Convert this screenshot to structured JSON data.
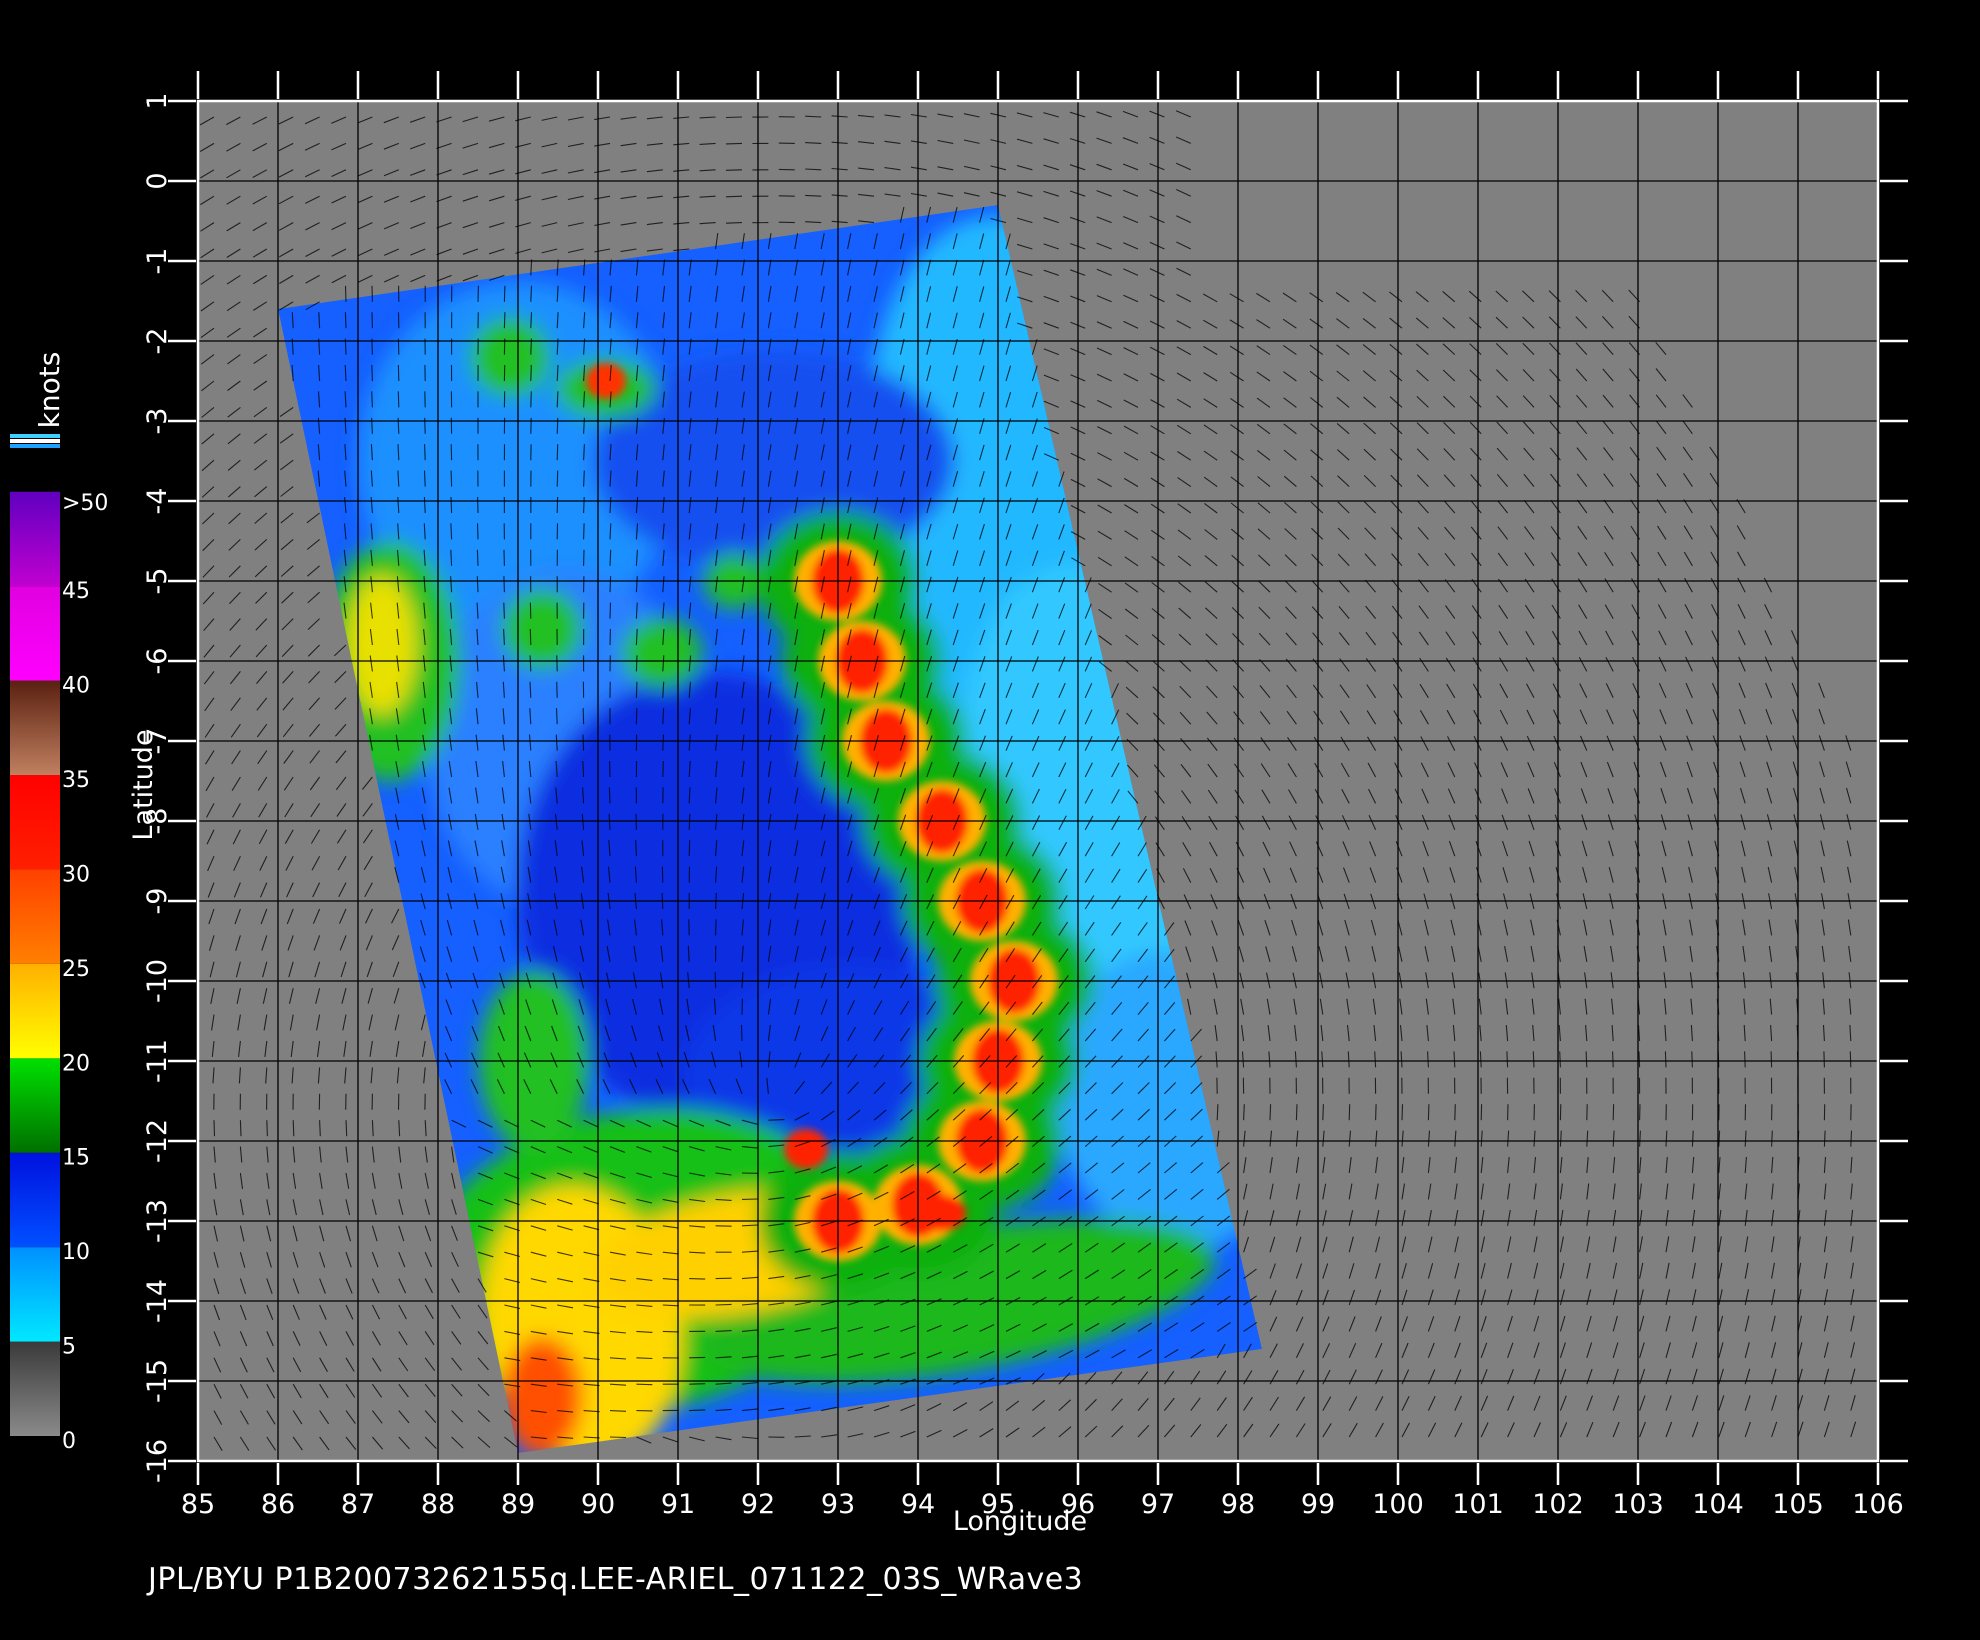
{
  "axes": {
    "xlabel": "Longitude",
    "ylabel": "Latitude",
    "lon_min": 85,
    "lon_max": 106,
    "lat_max": 1,
    "lat_min": -16,
    "lon_ticks": [
      "85",
      "86",
      "87",
      "88",
      "89",
      "90",
      "91",
      "92",
      "93",
      "94",
      "95",
      "96",
      "97",
      "98",
      "99",
      "100",
      "101",
      "102",
      "103",
      "104",
      "105",
      "106"
    ],
    "lat_ticks": [
      "1",
      "0",
      "-1",
      "-2",
      "-3",
      "-4",
      "-5",
      "-6",
      "-7",
      "-8",
      "-9",
      "-10",
      "-11",
      "-12",
      "-13",
      "-14",
      "-15",
      "-16"
    ],
    "grid": true
  },
  "colorbar": {
    "title": "knots",
    "labels": [
      ">50",
      "45",
      "40",
      "35",
      "30",
      "25",
      "20",
      "15",
      "10",
      "5",
      "0"
    ],
    "segments": [
      {
        "from": 0,
        "to": 5,
        "colors": [
          "#8a8a8a",
          "#3a3a3a"
        ]
      },
      {
        "from": 5,
        "to": 10,
        "colors": [
          "#00e8ff",
          "#0090ff"
        ]
      },
      {
        "from": 10,
        "to": 15,
        "colors": [
          "#0050ff",
          "#0010e0"
        ]
      },
      {
        "from": 15,
        "to": 20,
        "colors": [
          "#007000",
          "#00e000"
        ]
      },
      {
        "from": 20,
        "to": 25,
        "colors": [
          "#ffff00",
          "#ffb000"
        ]
      },
      {
        "from": 25,
        "to": 30,
        "colors": [
          "#ff8000",
          "#ff4000"
        ]
      },
      {
        "from": 30,
        "to": 35,
        "colors": [
          "#ff2000",
          "#ff0000"
        ]
      },
      {
        "from": 35,
        "to": 40,
        "colors": [
          "#c08060",
          "#5a2010"
        ]
      },
      {
        "from": 40,
        "to": 45,
        "colors": [
          "#ff00ff",
          "#e000e0"
        ]
      },
      {
        "from": 45,
        "to": 50,
        "colors": [
          "#c000d0",
          "#6000c0"
        ]
      }
    ]
  },
  "swath": {
    "corners_lonlat": [
      [
        86.0,
        -1.6
      ],
      [
        95.0,
        -0.3
      ],
      [
        98.3,
        -14.6
      ],
      [
        89.0,
        -15.9
      ]
    ]
  },
  "wind_field": {
    "rainband": [
      [
        93.0,
        -5.0
      ],
      [
        93.3,
        -6.0
      ],
      [
        93.6,
        -7.0
      ],
      [
        94.3,
        -8.0
      ],
      [
        94.8,
        -9.0
      ],
      [
        95.2,
        -10.0
      ],
      [
        95.0,
        -11.0
      ],
      [
        94.8,
        -12.0
      ],
      [
        94.0,
        -12.8
      ],
      [
        93.0,
        -13.0
      ]
    ],
    "eye_center": [
      92.2,
      -11.5
    ],
    "max_speed_kt": 35
  },
  "footer_text": "JPL/BYU  P1B20073262155q.LEE-ARIEL_071122_03S_WRave3",
  "colors": {
    "background": "#000000",
    "land_mask": "#808080",
    "axis": "#ffffff",
    "grid": "#000000"
  }
}
